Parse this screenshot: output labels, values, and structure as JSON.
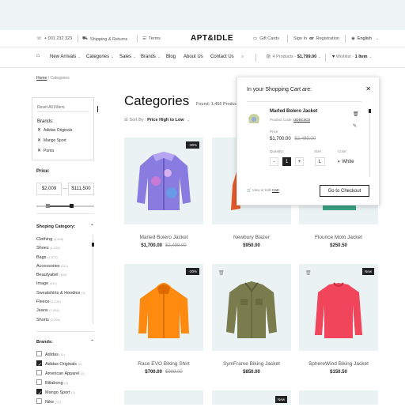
{
  "topbar": {
    "phone": "+ 001 232 323",
    "shipping": "Shipping & Returns",
    "terms": "Terms",
    "logo": "APT&IDLE",
    "gift_cards": "Gift Cards",
    "sign_in": "Sign In",
    "or": "or",
    "register": "Registration",
    "language": "English"
  },
  "nav": {
    "items": [
      "New Arrivals",
      "Categories",
      "Sales",
      "Brands",
      "Blog",
      "About Us",
      "Contact Us"
    ],
    "cart_summary": "4 Products - ",
    "cart_total": "$1,799.00",
    "wishlist": "Wishlist - ",
    "wishlist_count": "1 Item"
  },
  "breadcrumb": {
    "home": "Home",
    "sep": "/",
    "current": "Categories"
  },
  "filters": {
    "reset": "Reset All Filters",
    "brands_title": "Brands:",
    "active": [
      "Adidas Originals",
      "Mango Sport",
      "Puma"
    ]
  },
  "price": {
    "title": "Price:",
    "min": "$2,009",
    "dash": "—",
    "max": "$111,500"
  },
  "shopping_category": {
    "title": "Shoping Category:",
    "items": [
      {
        "name": "Clothing",
        "count": "(1,825)"
      },
      {
        "name": "Shoes",
        "count": "(1,228)"
      },
      {
        "name": "Bags",
        "count": "(2,972)"
      },
      {
        "name": "Accessories",
        "count": "(811)"
      },
      {
        "name": "Beautyabel",
        "count": "(162)"
      },
      {
        "name": "Image",
        "count": "(311)"
      },
      {
        "name": "Sweatshirts & Hoodies",
        "count": "(3)"
      },
      {
        "name": "Fleece",
        "count": "(1,139)"
      },
      {
        "name": "Jeans",
        "count": "(1,554)"
      },
      {
        "name": "Shorts",
        "count": "(3,266)"
      }
    ]
  },
  "brands": {
    "title": "Brands:",
    "items": [
      {
        "name": "Adidas",
        "count": "(11)",
        "checked": false
      },
      {
        "name": "Adidas Originals",
        "count": "(1)",
        "checked": true
      },
      {
        "name": "American Apparel",
        "count": "(1)",
        "checked": false
      },
      {
        "name": "Billabong",
        "count": "(4)",
        "checked": false
      },
      {
        "name": "Mango Sport",
        "count": "(1)",
        "checked": true
      },
      {
        "name": "Nike",
        "count": "(12)",
        "checked": false
      }
    ]
  },
  "main": {
    "title": "Categories",
    "found": "Found: 1,456 Produc",
    "sort_label": "Sort By :",
    "sort_value": "Price High to Low"
  },
  "products": [
    {
      "name": "Marled Bolero Jacket",
      "price": "$1,700.00",
      "old": "$2,499.00",
      "badge": "-30%"
    },
    {
      "name": "Newbury Blazer",
      "price": "$950.00",
      "old": "",
      "badge": ""
    },
    {
      "name": "Flounce Moto Jacket",
      "price": "$250.50",
      "old": "",
      "badge": ""
    },
    {
      "name": "Race EVO Biking Shirt",
      "price": "$700.00",
      "old": "$999.00",
      "badge": "-20%"
    },
    {
      "name": "SymFrame Biking Jacket",
      "price": "$850.00",
      "old": "",
      "badge": ""
    },
    {
      "name": "SphereWind Biking Jacket",
      "price": "$150.50",
      "old": "",
      "badge": "New"
    }
  ],
  "bottom_badge": "New",
  "cart": {
    "title": "In your Shopping Cart are:",
    "item_name": "Marled Bolero Jacket",
    "code_label": "Product Code:",
    "code": "UDSC4C0",
    "price_label": "Price:",
    "price": "$1,700.00",
    "old_price": "$2,499.00",
    "qty_label": "Quantity:",
    "qty": "1",
    "size_label": "Size:",
    "size": "L",
    "color_label": "Color:",
    "color": "White",
    "view_prefix": "View or Edit",
    "view_link": "Cart",
    "checkout": "Go to Checkout"
  },
  "colors": {
    "accent": "#222222",
    "card_bg": "#eaf2f4",
    "topbar": "#eef4f4"
  }
}
